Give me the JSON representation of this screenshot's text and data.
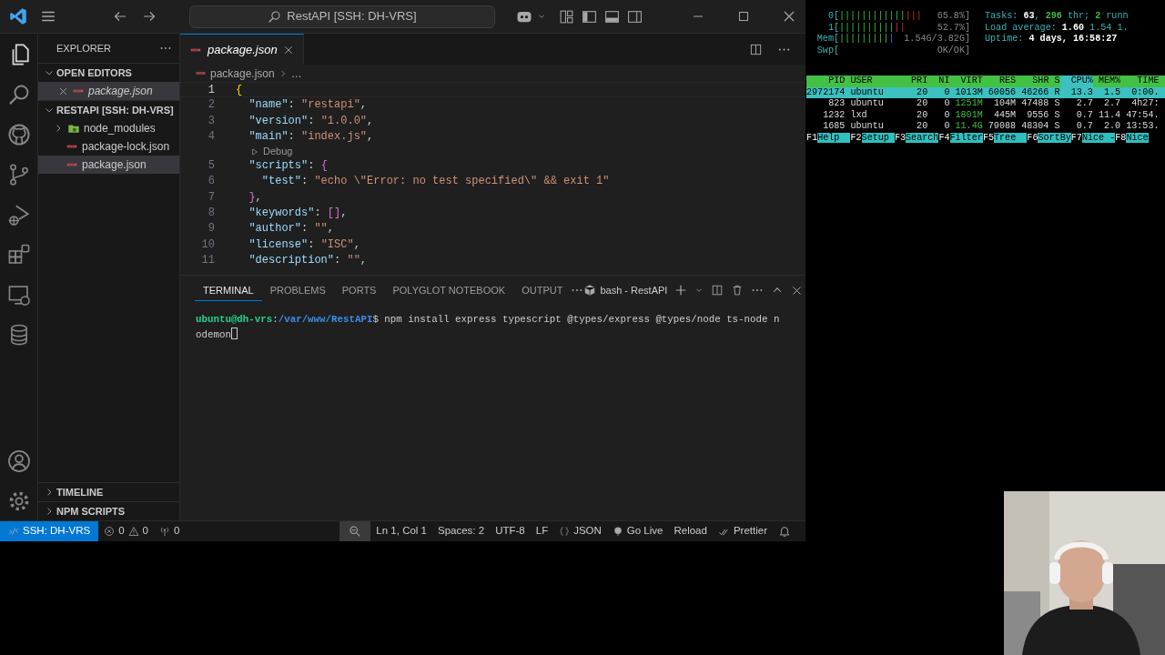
{
  "window": {
    "title": "RestAPI [SSH: DH-VRS]"
  },
  "activity_bar": {
    "items": [
      {
        "kind": "files",
        "selected": true
      },
      {
        "kind": "search",
        "selected": false
      },
      {
        "kind": "github",
        "selected": false
      },
      {
        "kind": "source-control",
        "selected": false
      },
      {
        "kind": "run-debug",
        "selected": false
      },
      {
        "kind": "extensions",
        "selected": false
      },
      {
        "kind": "remote",
        "selected": false
      },
      {
        "kind": "database",
        "selected": false
      }
    ],
    "bottom": [
      {
        "kind": "account"
      },
      {
        "kind": "settings"
      }
    ]
  },
  "sidebar": {
    "title": "EXPLORER",
    "sections": [
      {
        "title": "OPEN EDITORS",
        "expanded": true,
        "items": [
          {
            "label": "package.json",
            "kind": "file",
            "selected": true,
            "preview": true,
            "closable": true
          }
        ]
      },
      {
        "title": "RESTAPI [SSH: DH-VRS]",
        "expanded": true,
        "items": [
          {
            "label": "node_modules",
            "kind": "folder",
            "expanded": false,
            "selected": false
          },
          {
            "label": "package-lock.json",
            "kind": "file",
            "selected": false
          },
          {
            "label": "package.json",
            "kind": "file",
            "selected": true
          }
        ]
      },
      {
        "title": "TIMELINE",
        "expanded": false
      },
      {
        "title": "NPM SCRIPTS",
        "expanded": false
      }
    ]
  },
  "editor": {
    "tabs": [
      {
        "label": "package.json",
        "selected": true,
        "preview": true
      }
    ],
    "breadcrumb": [
      "package.json",
      "…"
    ],
    "lines": [
      {
        "kind": "code",
        "number": "1",
        "active": true,
        "tokens": [
          {
            "text": "{",
            "kind": "brace1"
          }
        ]
      },
      {
        "kind": "code",
        "number": "2",
        "tokens": [
          {
            "text": "  \"name\"",
            "kind": "key"
          },
          {
            "text": ": ",
            "kind": "punct"
          },
          {
            "text": "\"restapi\"",
            "kind": "str"
          },
          {
            "text": ",",
            "kind": "punct"
          }
        ]
      },
      {
        "kind": "code",
        "number": "3",
        "tokens": [
          {
            "text": "  \"version\"",
            "kind": "key"
          },
          {
            "text": ": ",
            "kind": "punct"
          },
          {
            "text": "\"1.0.0\"",
            "kind": "str"
          },
          {
            "text": ",",
            "kind": "punct"
          }
        ]
      },
      {
        "kind": "code",
        "number": "4",
        "tokens": [
          {
            "text": "  \"main\"",
            "kind": "key"
          },
          {
            "text": ": ",
            "kind": "punct"
          },
          {
            "text": "\"index.js\"",
            "kind": "str"
          },
          {
            "text": ",",
            "kind": "punct"
          }
        ]
      },
      {
        "kind": "codelens",
        "label": "Debug"
      },
      {
        "kind": "code",
        "number": "5",
        "tokens": [
          {
            "text": "  \"scripts\"",
            "kind": "key"
          },
          {
            "text": ": ",
            "kind": "punct"
          },
          {
            "text": "{",
            "kind": "brace2"
          }
        ]
      },
      {
        "kind": "code",
        "number": "6",
        "tokens": [
          {
            "text": "    \"test\"",
            "kind": "key"
          },
          {
            "text": ": ",
            "kind": "punct"
          },
          {
            "text": "\"echo \\\"Error: no test specified\\\" && exit 1\"",
            "kind": "str"
          }
        ]
      },
      {
        "kind": "code",
        "number": "7",
        "tokens": [
          {
            "text": "  }",
            "kind": "brace2"
          },
          {
            "text": ",",
            "kind": "punct"
          }
        ]
      },
      {
        "kind": "code",
        "number": "8",
        "tokens": [
          {
            "text": "  \"keywords\"",
            "kind": "key"
          },
          {
            "text": ": ",
            "kind": "punct"
          },
          {
            "text": "[]",
            "kind": "brace2"
          },
          {
            "text": ",",
            "kind": "punct"
          }
        ]
      },
      {
        "kind": "code",
        "number": "9",
        "tokens": [
          {
            "text": "  \"author\"",
            "kind": "key"
          },
          {
            "text": ": ",
            "kind": "punct"
          },
          {
            "text": "\"\"",
            "kind": "str"
          },
          {
            "text": ",",
            "kind": "punct"
          }
        ]
      },
      {
        "kind": "code",
        "number": "10",
        "tokens": [
          {
            "text": "  \"license\"",
            "kind": "key"
          },
          {
            "text": ": ",
            "kind": "punct"
          },
          {
            "text": "\"ISC\"",
            "kind": "str"
          },
          {
            "text": ",",
            "kind": "punct"
          }
        ]
      },
      {
        "kind": "code",
        "number": "11",
        "tokens": [
          {
            "text": "  \"description\"",
            "kind": "key"
          },
          {
            "text": ": ",
            "kind": "punct"
          },
          {
            "text": "\"\"",
            "kind": "str"
          },
          {
            "text": ",",
            "kind": "punct"
          }
        ]
      }
    ]
  },
  "panel": {
    "tabs": [
      {
        "label": "TERMINAL",
        "selected": true
      },
      {
        "label": "PROBLEMS",
        "selected": false
      },
      {
        "label": "PORTS",
        "selected": false
      },
      {
        "label": "POLYGLOT NOTEBOOK",
        "selected": false
      },
      {
        "label": "OUTPUT",
        "selected": false
      }
    ],
    "terminal_name": "bash - RestAPI",
    "terminal_lines": [
      [
        {
          "text": "ubuntu@dh-vrs",
          "kind": "user"
        },
        {
          "text": ":",
          "kind": "plain"
        },
        {
          "text": "/var/www/RestAPI",
          "kind": "path"
        },
        {
          "text": "$ npm install express typescript @types/express @types/node ts-node n",
          "kind": "plain"
        }
      ],
      [
        {
          "text": "odemon",
          "kind": "plain"
        }
      ]
    ]
  },
  "status_bar": {
    "left": [
      {
        "kind": "remote",
        "text": "SSH: DH-VRS"
      },
      {
        "kind": "problems",
        "errors": "0",
        "warnings": "0"
      },
      {
        "kind": "ports",
        "text": "0"
      }
    ],
    "right": [
      {
        "kind": "zoom"
      },
      {
        "kind": "text",
        "text": "Ln 1, Col 1"
      },
      {
        "kind": "text",
        "text": "Spaces: 2"
      },
      {
        "kind": "text",
        "text": "UTF-8"
      },
      {
        "kind": "text",
        "text": "LF"
      },
      {
        "kind": "language",
        "text": "JSON"
      },
      {
        "kind": "golive",
        "text": "Go Live"
      },
      {
        "kind": "text",
        "text": "Reload"
      },
      {
        "kind": "prettier",
        "text": "Prettier"
      },
      {
        "kind": "bell"
      }
    ]
  },
  "htop": {
    "meters": [
      {
        "label": "0[",
        "bar": [
          {
            "text": "||||||||||||",
            "kind": "user"
          },
          {
            "text": "|||",
            "kind": "kernel"
          }
        ],
        "reading": "65.8%]"
      },
      {
        "label": "1[",
        "bar": [
          {
            "text": "||||||||||",
            "kind": "user"
          },
          {
            "text": "||",
            "kind": "kernel"
          }
        ],
        "reading": "52.7%]"
      },
      {
        "label": "Mem[",
        "bar": [
          {
            "text": "|||||||||",
            "kind": "user"
          },
          {
            "text": "|",
            "kind": "buffer"
          }
        ],
        "reading": "1.54G/3.82G]"
      },
      {
        "label": "Swp[",
        "reading": "OK/OK]"
      }
    ],
    "info": [
      [
        {
          "text": "Tasks: ",
          "kind": "label"
        },
        {
          "text": "63",
          "kind": "value"
        },
        {
          "text": ", ",
          "kind": "label"
        },
        {
          "text": "296",
          "kind": "value2"
        },
        {
          "text": " thr; ",
          "kind": "label"
        },
        {
          "text": "2",
          "kind": "value2"
        },
        {
          "text": " runn",
          "kind": "label"
        }
      ],
      [
        {
          "text": "Load average: ",
          "kind": "label"
        },
        {
          "text": "1.60",
          "kind": "value"
        },
        {
          "text": " 1.54 1.",
          "kind": "label"
        }
      ],
      [
        {
          "text": "Uptime: ",
          "kind": "label"
        },
        {
          "text": "4 days, 16:58:27",
          "kind": "value"
        }
      ]
    ],
    "columns": [
      {
        "label": "PID",
        "selected": false
      },
      {
        "label": "USER",
        "selected": false
      },
      {
        "label": "PRI",
        "selected": false
      },
      {
        "label": "NI",
        "selected": false
      },
      {
        "label": "VIRT",
        "selected": false
      },
      {
        "label": "RES",
        "selected": false
      },
      {
        "label": "SHR",
        "selected": false
      },
      {
        "label": "S",
        "selected": false
      },
      {
        "label": "CPU%",
        "selected": true
      },
      {
        "label": "MEM%",
        "selected": false
      },
      {
        "label": "TIME",
        "selected": false
      }
    ],
    "rows": [
      {
        "selected": true,
        "cells": [
          "2972174",
          "ubuntu",
          "20",
          "0",
          "1013M",
          "60056",
          "46266",
          "R",
          "13.3",
          "1.5",
          "0:00."
        ]
      },
      {
        "selected": false,
        "cells": [
          "823",
          "ubuntu",
          "20",
          "0",
          "1251M",
          "104M",
          "47488",
          "S",
          "2.7",
          "2.7",
          "4h27:"
        ]
      },
      {
        "selected": false,
        "cells": [
          "1232",
          "lxd",
          "20",
          "0",
          "1801M",
          "445M",
          "9556",
          "S",
          "0.7",
          "11.4",
          "47:54."
        ]
      },
      {
        "selected": false,
        "cells": [
          "1685",
          "ubuntu",
          "20",
          "0",
          "11.4G",
          "79088",
          "48304",
          "S",
          "0.7",
          "2.0",
          "13:53."
        ]
      }
    ],
    "function_keys": [
      {
        "key": "F1",
        "label": "Help  "
      },
      {
        "key": "F2",
        "label": "Setup "
      },
      {
        "key": "F3",
        "label": "Search"
      },
      {
        "key": "F4",
        "label": "Filter"
      },
      {
        "key": "F5",
        "label": "Tree  "
      },
      {
        "key": "F6",
        "label": "SortBy"
      },
      {
        "key": "F7",
        "label": "Nice -"
      },
      {
        "key": "F8",
        "label": "Nice"
      }
    ]
  }
}
